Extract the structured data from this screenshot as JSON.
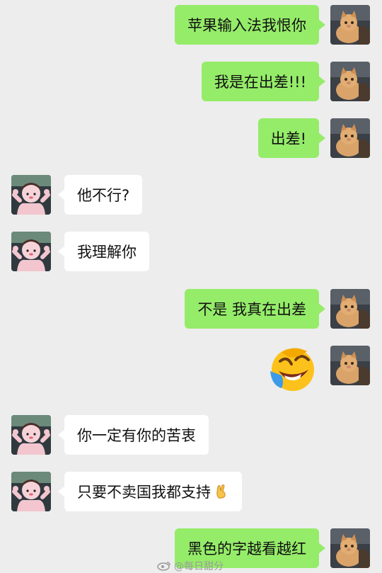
{
  "messages": [
    {
      "side": "me",
      "text": "苹果输入法我恨你"
    },
    {
      "side": "me",
      "text": "我是在出差!!!"
    },
    {
      "side": "me",
      "text": "出差!"
    },
    {
      "side": "other",
      "text": "他不行?"
    },
    {
      "side": "other",
      "text": "我理解你"
    },
    {
      "side": "me",
      "text": "不是 我真在出差"
    },
    {
      "side": "me",
      "emoji": "laughing-crying-emoji"
    },
    {
      "side": "other",
      "text": "你一定有你的苦衷"
    },
    {
      "side": "other",
      "text": "只要不卖国我都支持",
      "emoji": "fingers-crossed-emoji"
    },
    {
      "side": "me",
      "text": "黑色的字越看越红"
    }
  ],
  "watermark": {
    "text": "@每日甜分"
  },
  "colors": {
    "background": "#ededed",
    "my_bubble": "#95ec69",
    "other_bubble": "#ffffff"
  }
}
